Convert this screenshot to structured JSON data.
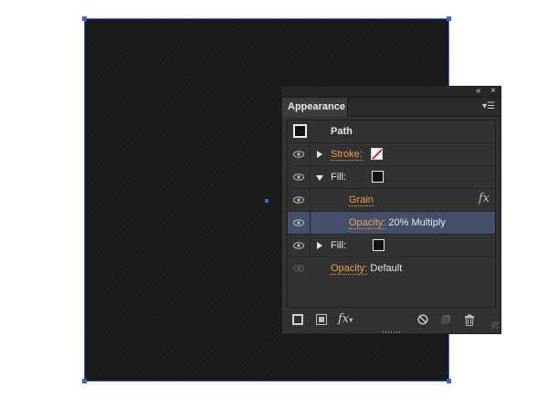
{
  "panel": {
    "title": "Appearance",
    "collapse_icon": "double-chevron-left-icon",
    "close_icon": "close-icon",
    "menu_icon": "panel-menu-icon"
  },
  "appearance": {
    "header": {
      "label": "Path"
    },
    "rows": [
      {
        "name": "Stroke",
        "label": "Stroke:",
        "swatch": "none",
        "expanded": false
      },
      {
        "name": "Fill",
        "label": "Fill:",
        "swatch": "black",
        "expanded": true
      },
      {
        "name": "Grain",
        "label": "Grain",
        "fx": "fx"
      },
      {
        "name": "Opacity",
        "label": "Opacity:",
        "value": "20% Multiply",
        "selected": true
      },
      {
        "name": "Fill",
        "label": "Fill:",
        "swatch": "black",
        "expanded": false
      },
      {
        "name": "Opacity",
        "label": "Opacity:",
        "value": "Default"
      }
    ]
  },
  "bottom_bar": {
    "icons": [
      "add-new-stroke-icon",
      "add-new-fill-icon",
      "add-new-effect-icon",
      "clear-appearance-icon",
      "duplicate-item-icon",
      "delete-item-icon"
    ],
    "fx_label": "fx"
  },
  "colors": {
    "accent_link": "#f0a04a",
    "selection_highlight": "#44506a",
    "selection_bounds": "#3d62d6"
  }
}
